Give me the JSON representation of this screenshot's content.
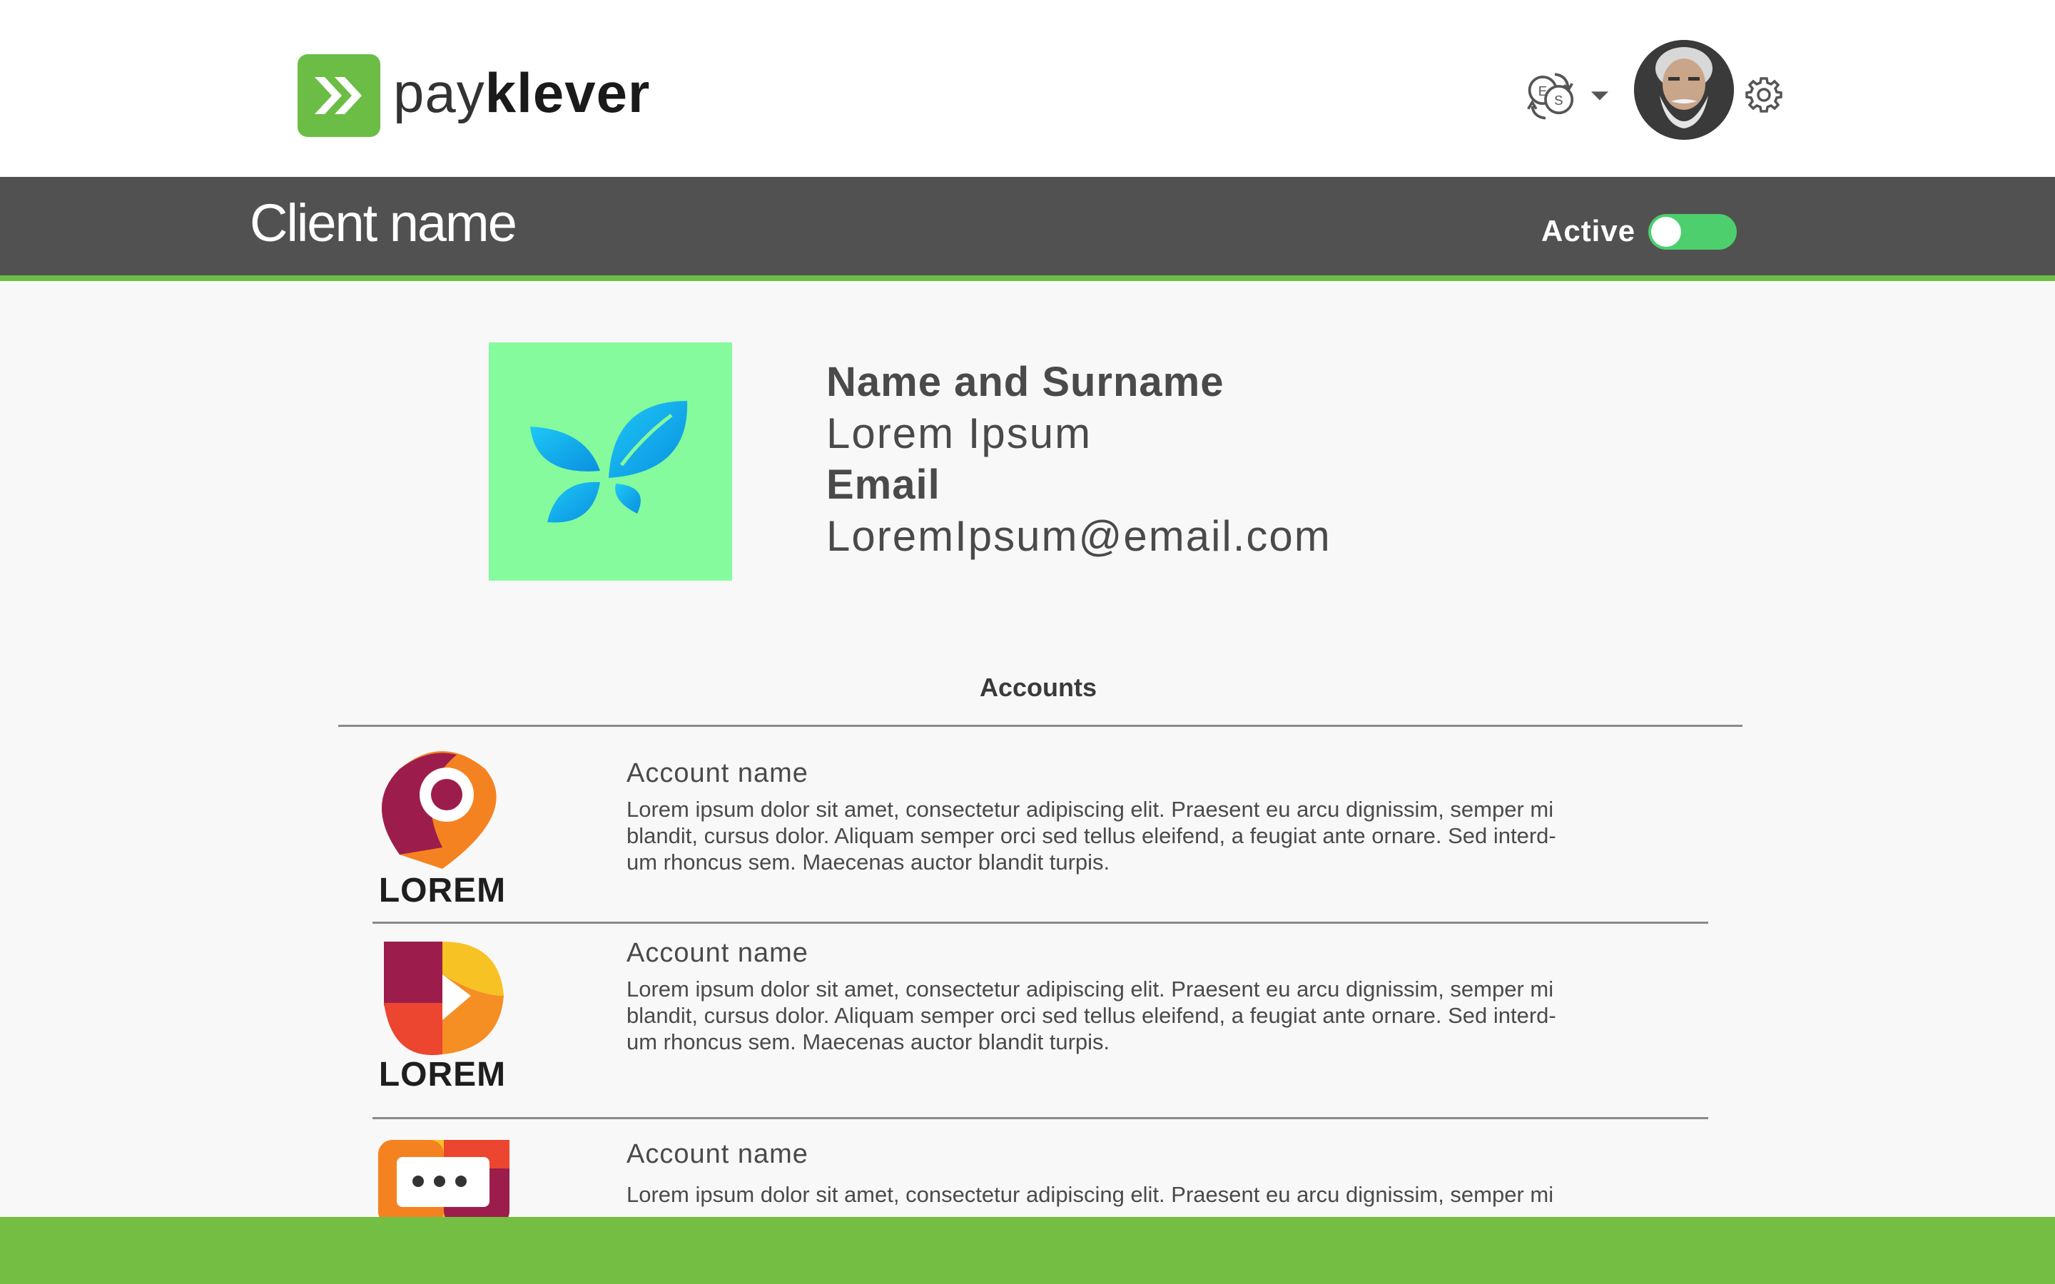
{
  "brand": {
    "name_light": "pay",
    "name_bold": "klever",
    "color": "#6cbd45"
  },
  "header": {
    "currency_icon": "currency-exchange-icon",
    "avatar_icon": "user-avatar",
    "settings_icon": "gear-icon"
  },
  "client": {
    "title": "Client name",
    "status_label": "Active",
    "status_on": true
  },
  "profile": {
    "name_label": "Name and Surname",
    "name_value": "Lorem Ipsum",
    "email_label": "Email",
    "email_value": "LoremIpsum@email.com",
    "image_icon": "butterfly-logo"
  },
  "accounts": {
    "title": "Accounts",
    "items": [
      {
        "logo_icon": "location-pin-logo",
        "logo_text": "LOREM",
        "name": "Account name",
        "desc_lines": [
          "Lorem ipsum dolor sit amet, consectetur adipiscing elit. Praesent eu arcu dignissim, semper mi",
          "blandit, cursus dolor. Aliquam semper orci sed tellus eleifend, a feugiat ante ornare. Sed interd-",
          "um rhoncus sem. Maecenas auctor blandit turpis."
        ]
      },
      {
        "logo_icon": "petal-logo",
        "logo_text": "LOREM",
        "name": "Account name",
        "desc_lines": [
          "Lorem ipsum dolor sit amet, consectetur adipiscing elit. Praesent eu arcu dignissim, semper mi",
          "blandit, cursus dolor. Aliquam semper orci sed tellus eleifend, a feugiat ante ornare. Sed interd-",
          "um rhoncus sem. Maecenas auctor blandit turpis."
        ]
      },
      {
        "logo_icon": "chat-bubble-logo",
        "name": "Account name",
        "desc_lines": [
          "Lorem ipsum dolor sit amet, consectetur adipiscing elit. Praesent eu arcu dignissim, semper mi"
        ]
      }
    ]
  },
  "colors": {
    "header_bar": "#515151",
    "accent_green": "#6cbd45",
    "toggle_green": "#4ccf6c",
    "profile_bg": "#85fb9e",
    "bottom_bar": "#74be44"
  }
}
